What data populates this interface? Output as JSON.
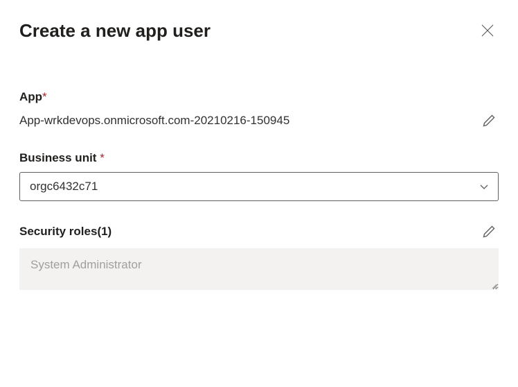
{
  "header": {
    "title": "Create a new app user"
  },
  "app": {
    "label": "App",
    "required_mark": "*",
    "value": "App-wrkdevops.onmicrosoft.com-20210216-150945"
  },
  "business_unit": {
    "label": "Business unit ",
    "required_mark": "*",
    "value": "orgc6432c71"
  },
  "security_roles": {
    "label": "Security roles(1)",
    "items": [
      "System Administrator"
    ]
  }
}
